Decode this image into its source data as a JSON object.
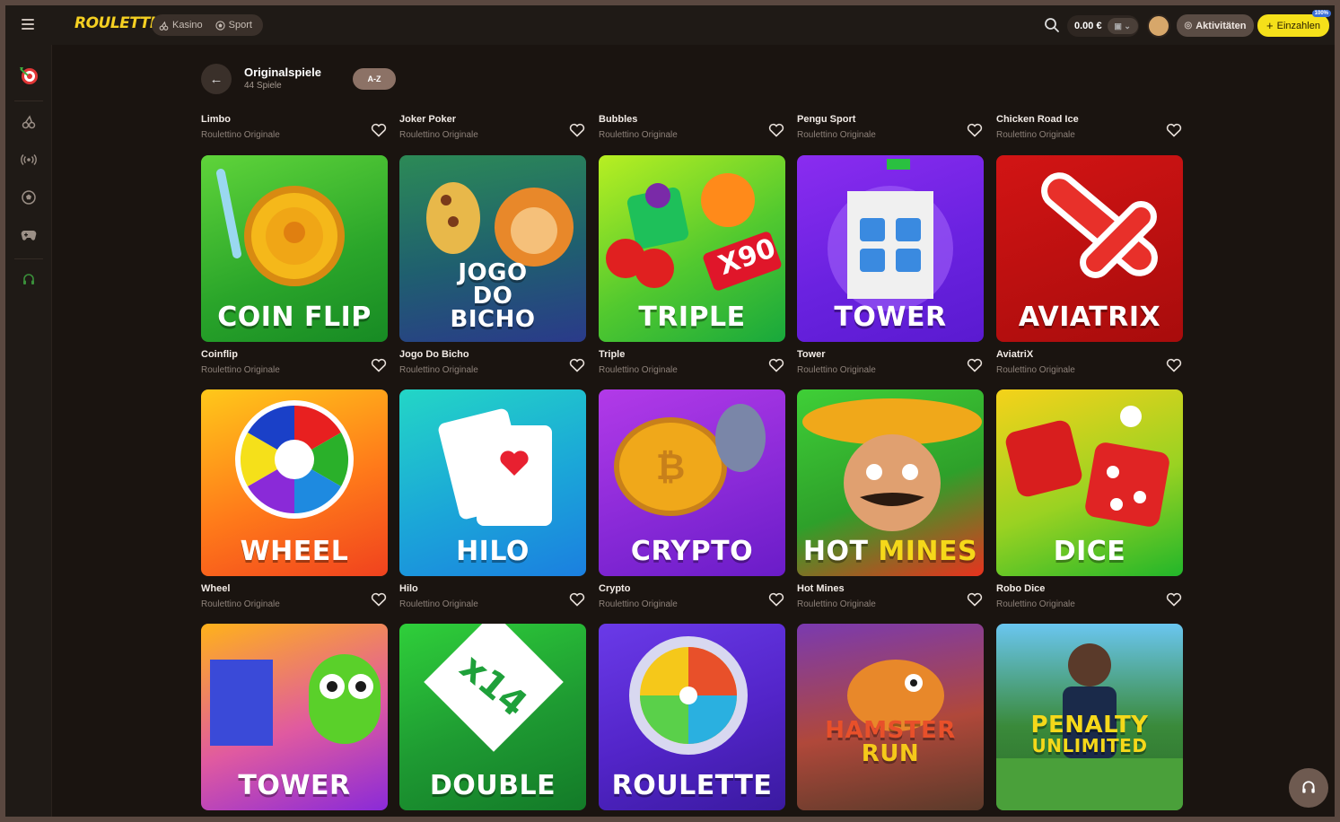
{
  "header": {
    "logo": "ROULETTINO",
    "nav": [
      {
        "label": "Kasino",
        "icon": "cherry-icon"
      },
      {
        "label": "Sport",
        "icon": "football-icon"
      }
    ],
    "balance": "0.00 €",
    "activities_label": "Aktivitäten",
    "deposit_label": "Einzahlen",
    "deposit_badge": "100%"
  },
  "sidebar": {
    "items": [
      {
        "name": "originals",
        "icon": "target-icon"
      },
      {
        "name": "casino",
        "icon": "cherry-icon"
      },
      {
        "name": "live",
        "icon": "live-broadcast-icon"
      },
      {
        "name": "sports",
        "icon": "football-icon"
      },
      {
        "name": "esports",
        "icon": "gamepad-icon"
      },
      {
        "name": "support",
        "icon": "headset-icon"
      }
    ]
  },
  "page": {
    "title": "Originalspiele",
    "subtitle": "44 Spiele",
    "sort_label": "A-Z"
  },
  "top_labels": [
    {
      "title": "Limbo",
      "provider": "Roulettino Originale"
    },
    {
      "title": "Joker Poker",
      "provider": "Roulettino Originale"
    },
    {
      "title": "Bubbles",
      "provider": "Roulettino Originale"
    },
    {
      "title": "Pengu Sport",
      "provider": "Roulettino Originale"
    },
    {
      "title": "Chicken Road Ice",
      "provider": "Roulettino Originale"
    }
  ],
  "games": [
    {
      "title": "Coinflip",
      "provider": "Roulettino Originale",
      "tile_text": "COIN FLIP"
    },
    {
      "title": "Jogo Do Bicho",
      "provider": "Roulettino Originale",
      "tile_text": "JOGO DO BICHO"
    },
    {
      "title": "Triple",
      "provider": "Roulettino Originale",
      "tile_text": "TRIPLE",
      "tile_extra": "X90"
    },
    {
      "title": "Tower",
      "provider": "Roulettino Originale",
      "tile_text": "TOWER"
    },
    {
      "title": "AviatriX",
      "provider": "Roulettino Originale",
      "tile_text": "AVIATRIX"
    },
    {
      "title": "Wheel",
      "provider": "Roulettino Originale",
      "tile_text": "WHEEL"
    },
    {
      "title": "Hilo",
      "provider": "Roulettino Originale",
      "tile_text": "HILO"
    },
    {
      "title": "Crypto",
      "provider": "Roulettino Originale",
      "tile_text": "CRYPTO"
    },
    {
      "title": "Hot Mines",
      "provider": "Roulettino Originale",
      "tile_text": "HOT",
      "tile_text_2": "MINES"
    },
    {
      "title": "Robo Dice",
      "provider": "Roulettino Originale",
      "tile_text": "DICE"
    },
    {
      "title": "",
      "provider": "",
      "tile_text": "TOWER"
    },
    {
      "title": "",
      "provider": "",
      "tile_text": "DOUBLE",
      "tile_extra": "x14"
    },
    {
      "title": "",
      "provider": "",
      "tile_text": "ROULETTE"
    },
    {
      "title": "",
      "provider": "",
      "tile_text": "HAMSTER",
      "tile_text_2": "RUN"
    },
    {
      "title": "",
      "provider": "",
      "tile_text": "PENALTY",
      "tile_text_2": "UNLIMITED"
    }
  ],
  "colors": {
    "accent_yellow": "#f5e01a",
    "background": "#1a1410",
    "sidebar": "#1f1a16"
  }
}
